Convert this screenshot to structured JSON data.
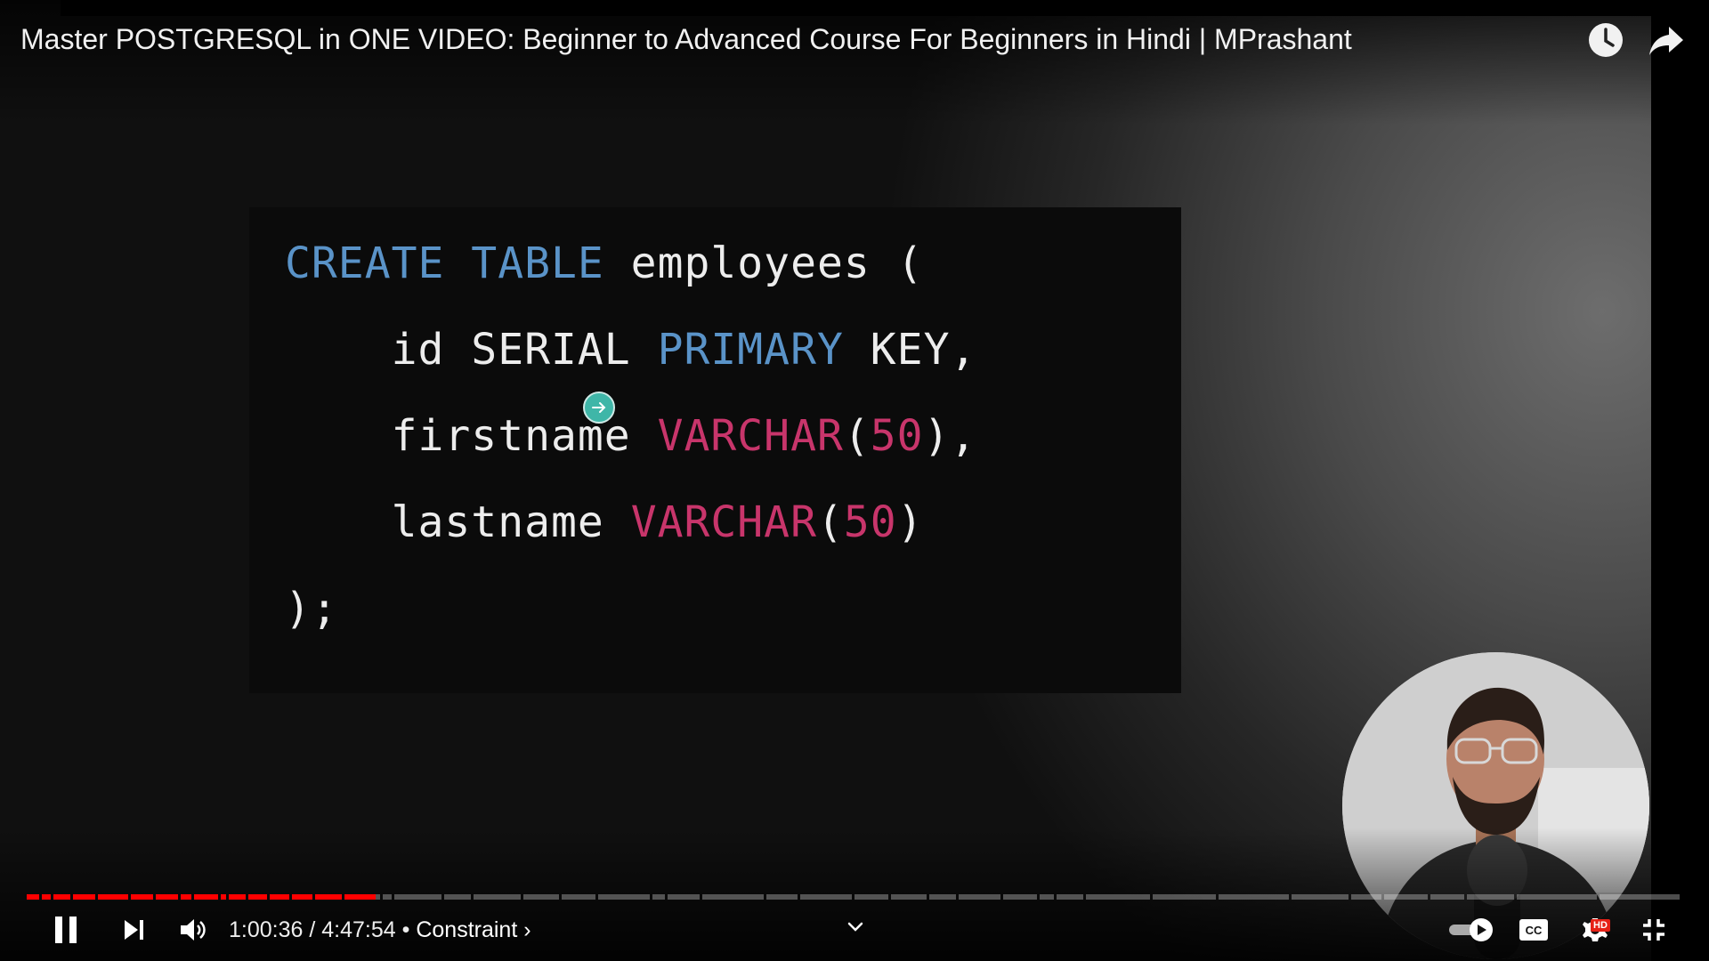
{
  "video": {
    "title": "Master POSTGRESQL in ONE VIDEO: Beginner to Advanced Course For Beginners in Hindi | MPrashant"
  },
  "top_actions": [
    {
      "name": "watch-later-icon"
    },
    {
      "name": "share-icon"
    }
  ],
  "slide": {
    "lines": [
      {
        "indent": "",
        "tokens": [
          {
            "text": "CREATE TABLE",
            "color": "#5a93c8"
          },
          {
            "text": " employees (",
            "color": "#ededed"
          }
        ]
      },
      {
        "indent": "    ",
        "tokens": [
          {
            "text": "id SERIAL ",
            "color": "#ededed"
          },
          {
            "text": "PRIMARY",
            "color": "#5a93c8"
          },
          {
            "text": " KEY,",
            "color": "#ededed"
          }
        ]
      },
      {
        "indent": "    ",
        "tokens": [
          {
            "text": "firstname ",
            "color": "#ededed"
          },
          {
            "text": "VARCHAR",
            "color": "#c8356b"
          },
          {
            "text": "(",
            "color": "#ededed"
          },
          {
            "text": "50",
            "color": "#c8356b"
          },
          {
            "text": "),",
            "color": "#ededed"
          }
        ]
      },
      {
        "indent": "    ",
        "tokens": [
          {
            "text": "lastname ",
            "color": "#ededed"
          },
          {
            "text": "VARCHAR",
            "color": "#c8356b"
          },
          {
            "text": "(",
            "color": "#ededed"
          },
          {
            "text": "50",
            "color": "#c8356b"
          },
          {
            "text": ")",
            "color": "#ededed"
          }
        ]
      },
      {
        "indent": "",
        "tokens": [
          {
            "text": ");",
            "color": "#ededed"
          }
        ]
      }
    ]
  },
  "controls": {
    "time_display": "1:00:36 / 4:47:54",
    "separator": " • ",
    "chapter": "Constraint",
    "chapter_chevron": "›",
    "hd_badge": "HD",
    "progress": {
      "current_seconds": 3636,
      "duration_seconds": 17274
    }
  },
  "colors": {
    "progress_played": "#ff0000",
    "hd_badge": "#e62117",
    "keyword_blue": "#5a93c8",
    "keyword_pink": "#c8356b"
  }
}
